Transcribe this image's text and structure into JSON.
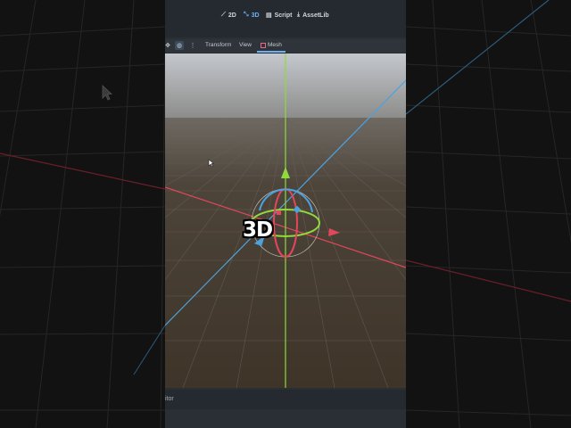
{
  "topbar": {
    "workspaces": [
      {
        "label": "2D",
        "icon": "2d-icon",
        "active": false
      },
      {
        "label": "3D",
        "icon": "3d-icon",
        "active": true
      },
      {
        "label": "Script",
        "icon": "script-icon",
        "active": false
      },
      {
        "label": "AssetLib",
        "icon": "assetlib-icon",
        "active": false
      }
    ]
  },
  "toolbar": {
    "transform_label": "Transform",
    "view_label": "View",
    "mesh_label": "Mesh"
  },
  "bottombar": {
    "label": "itor"
  },
  "overlay": {
    "text": "3D"
  },
  "colors": {
    "x_axis": "#e2475b",
    "y_axis": "#8fd93c",
    "z_axis": "#4aa3e0",
    "accent": "#6ab0f3"
  }
}
